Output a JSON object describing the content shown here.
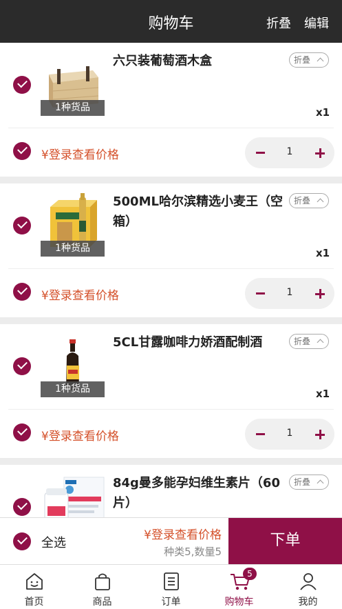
{
  "header": {
    "title": "购物车",
    "fold_label": "折叠",
    "edit_label": "编辑"
  },
  "items": [
    {
      "name": "六只装葡萄酒木盒",
      "kinds_label": "1种货品",
      "fold_tag": "折叠",
      "quantity_text": "x1",
      "price_text": "¥登录查看价格",
      "quantity": "1",
      "checked": true
    },
    {
      "name": "500ML哈尔滨精选小麦王（空箱）",
      "kinds_label": "1种货品",
      "fold_tag": "折叠",
      "quantity_text": "x1",
      "price_text": "¥登录查看价格",
      "quantity": "1",
      "checked": true
    },
    {
      "name": "5CL甘露咖啡力娇酒配制酒",
      "kinds_label": "1种货品",
      "fold_tag": "折叠",
      "quantity_text": "x1",
      "price_text": "¥登录查看价格",
      "quantity": "1",
      "checked": true
    },
    {
      "name": "84g曼多能孕妇维生素片（60片）",
      "kinds_label": "",
      "fold_tag": "折叠",
      "quantity_text": "",
      "price_text": "",
      "quantity": "",
      "checked": true
    }
  ],
  "footer": {
    "select_all_label": "全选",
    "total_price": "¥登录查看价格",
    "summary": "种类5,数量5",
    "order_button": "下单"
  },
  "tabbar": {
    "tabs": [
      {
        "label": "首页",
        "icon": "smiley-home-icon"
      },
      {
        "label": "商品",
        "icon": "shopping-bag-icon"
      },
      {
        "label": "订单",
        "icon": "order-list-icon"
      },
      {
        "label": "购物车",
        "icon": "cart-icon",
        "badge": "5",
        "active": true
      },
      {
        "label": "我的",
        "icon": "user-icon"
      }
    ]
  },
  "colors": {
    "accent": "#8f1047",
    "price": "#d4502a",
    "header_bg": "#2b2b2b"
  }
}
